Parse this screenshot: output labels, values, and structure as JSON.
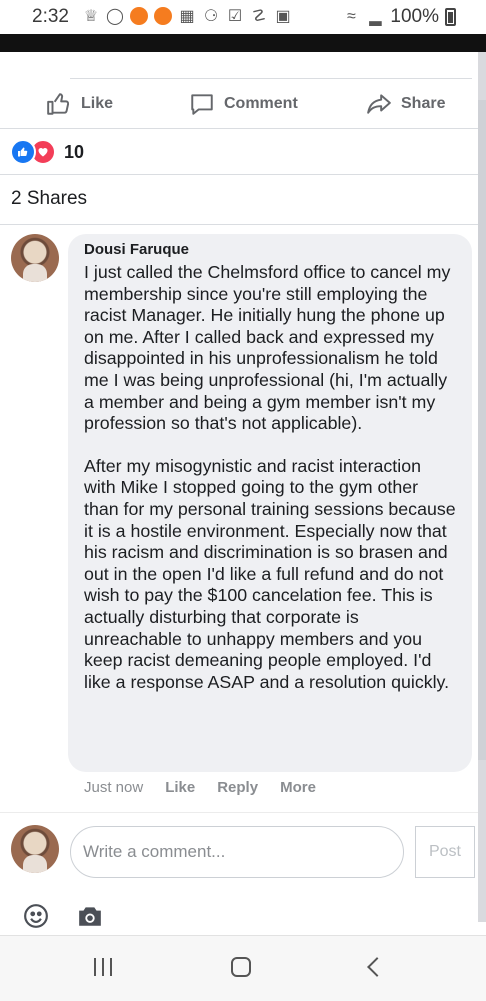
{
  "status_bar": {
    "time": "2:32",
    "battery": "100%",
    "icons": [
      "snapchat-icon",
      "voicemail-icon",
      "notification-dot",
      "notification-dot",
      "news-icon",
      "activity-icon",
      "checkbox-icon",
      "usb-icon",
      "image-icon",
      "wifi-icon",
      "signal-icon",
      "battery-icon"
    ]
  },
  "post_actions": {
    "like": "Like",
    "comment": "Comment",
    "share": "Share"
  },
  "reactions": {
    "count": "10",
    "types": [
      "like",
      "love"
    ],
    "colors": {
      "like": "#1877f2",
      "love": "#f33e58"
    }
  },
  "shares": "2 Shares",
  "comment": {
    "author": "Dousi Faruque",
    "paragraphs": [
      "I just called the Chelmsford office to cancel my membership since you're still employing the racist Manager. He initially hung the phone up on me. After I called back and expressed my disappointed in his unprofessionalism he told me I was being unprofessional (hi, I'm actually a member and being a gym member isn't my profession so that's not applicable).",
      "After my misogynistic and racist interaction with Mike I stopped going to the gym other than for my personal training sessions because it is a hostile environment. Especially now that his racism and discrimination is so brasen and out in the open I'd like a full refund and do not wish to pay the $100 cancelation fee. This is actually disturbing that corporate is unreachable to unhappy members and you keep racist demeaning people employed. I'd like a response ASAP and a resolution quickly."
    ],
    "time": "Just now",
    "like": "Like",
    "reply": "Reply",
    "more": "More"
  },
  "composer": {
    "placeholder": "Write a comment...",
    "post": "Post"
  }
}
